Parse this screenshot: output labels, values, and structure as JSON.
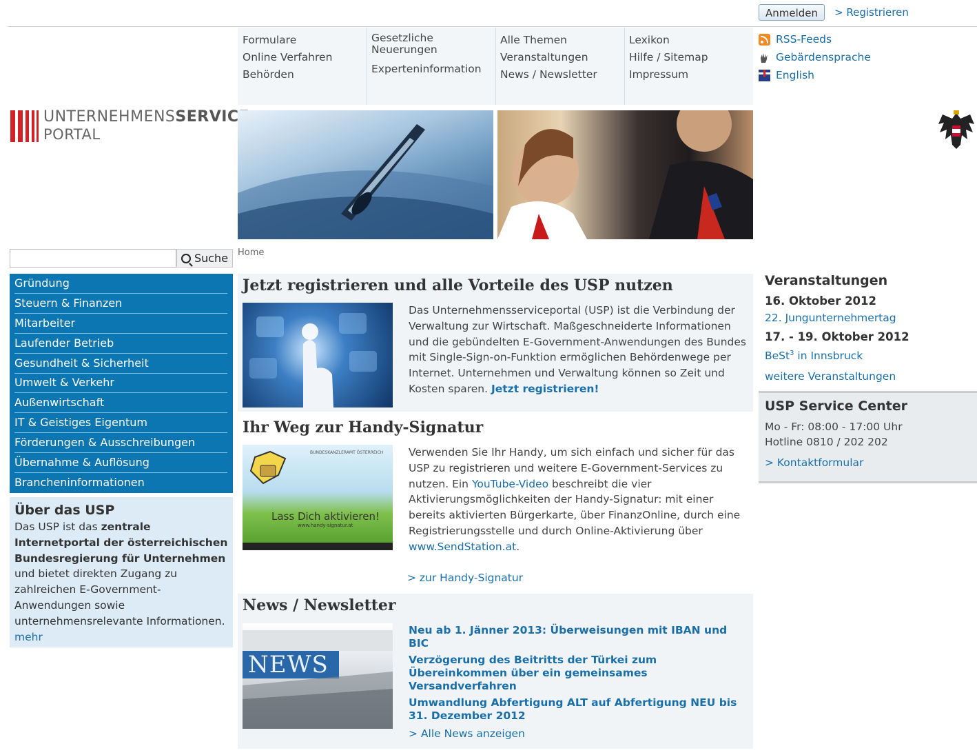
{
  "header": {
    "login_label": "Anmelden",
    "register_label": "> Registrieren"
  },
  "topnav": {
    "col1": [
      "Formulare",
      "Online Verfahren",
      "Behörden"
    ],
    "col2_line1": "Gesetzliche",
    "col2_line2": "Neuerungen",
    "col2_last": "Experteninformation",
    "col3": [
      "Alle Themen",
      "Veranstaltungen",
      "News / Newsletter"
    ],
    "col4": [
      "Lexikon",
      "Hilfe / Sitemap",
      "Impressum"
    ]
  },
  "service_links": {
    "rss": "RSS-Feeds",
    "sign": "Gebärdensprache",
    "english": "English"
  },
  "logo": {
    "line1_light": "UNTERNEHMENS",
    "line1_bold": "SERVICE",
    "line2": "PORTAL"
  },
  "search": {
    "placeholder": "",
    "button_label": "Suche"
  },
  "breadcrumb": "Home",
  "leftnav": [
    "Gründung",
    "Steuern & Finanzen",
    "Mitarbeiter",
    "Laufender Betrieb",
    "Gesundheit & Sicherheit",
    "Umwelt & Verkehr",
    "Außenwirtschaft",
    "IT & Geistiges Eigentum",
    "Förderungen & Ausschreibungen",
    "Übernahme & Auflösung",
    "Brancheninformationen"
  ],
  "about": {
    "title": "Über das USP",
    "t1": "Das USP ist das ",
    "b1": "zentrale Internetportal der österreichischen Bundesregierung für Unternehmen",
    "t2": " und bietet direkten Zugang zu zahlreichen E-Government-Anwendungen sowie unternehmensrelevante Informationen. ",
    "more": "mehr"
  },
  "register_section": {
    "title": "Jetzt registrieren und alle Vorteile des USP nutzen",
    "text": "Das Unternehmensserviceportal (USP) ist die Verbindung der Verwaltung zur Wirtschaft. Maßgeschneiderte Informationen und die gebündelten E-Government-Anwendungen des Bundes mit Single-Sign-on-Funktion ermöglichen Behördenwege per Internet. Unternehmen und Verwaltung können so Zeit und Kosten sparen. ",
    "cta": "Jetzt registrieren!"
  },
  "signature_section": {
    "title": "Ihr Weg zur Handy-Signatur",
    "t1": "Verwenden Sie Ihr Handy, um sich einfach und sicher für das USP zu registrieren und weitere E-Government-Services zu nutzen. Ein ",
    "yt": "YouTube-Video",
    "t2": " beschreibt die vier Aktivierungsmöglichkeiten der Handy-Signatur: mit einer bereits aktivierten Bürgerkarte, über FinanzOnline, durch eine Registrierungsstelle und durch Online-Aktivierung über ",
    "site": "www.SendStation.at",
    "t3": ".",
    "more": "> zur Handy-Signatur",
    "image_caption": "Lass Dich aktivieren!",
    "image_small": "www.handy-signatur.at",
    "image_header": "BUNDESKANZLERAMT ÖSTERREICH"
  },
  "news_section": {
    "title": "News / Newsletter",
    "items": [
      "Neu ab 1. Jänner 2013: Überweisungen mit IBAN und BIC",
      "Verzögerung des Beitritts der Türkei zum Übereinkommen über ein gemeinsames Versandverfahren",
      "Umwandlung Abfertigung ALT auf Abfertigung NEU bis 31. Dezember 2012"
    ],
    "all": "> Alle News anzeigen",
    "image_text": "NEWS"
  },
  "events": {
    "title": "Veranstaltungen",
    "date1": "16. Oktober 2012",
    "link1": "22. Jungunternehmertag",
    "date2": "17. - 19. Oktober 2012",
    "link2_pre": "BeSt",
    "link2_sup": "3",
    "link2_post": " in Innsbruck",
    "more": "weitere Veranstaltungen"
  },
  "service_center": {
    "title": "USP Service Center",
    "hours": "Mo - Fr: 08:00 - 17:00 Uhr",
    "hotline": "Hotline 0810 / 202 202",
    "contact": "> Kontaktformular"
  },
  "colors": {
    "accent_blue": "#0b76b2",
    "link": "#1a6fa8",
    "logo_red": "#d12229"
  }
}
